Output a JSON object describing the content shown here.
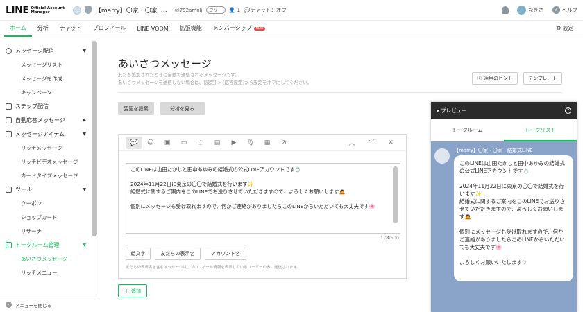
{
  "header": {
    "logo_main": "LINE",
    "logo_sub_1": "Official Account",
    "logo_sub_2": "Manager",
    "account_name": "【marry】〇家・〇家",
    "account_menu": "…",
    "account_id": "@792amnlj",
    "plan_badge": "フリー",
    "friends_count": "1",
    "chat_status": "チャット：オフ",
    "user_name": "なぎさ",
    "help_label": "ヘルプ"
  },
  "nav": {
    "tabs": [
      "ホーム",
      "分析",
      "チャット",
      "プロフィール",
      "LINE VOOM",
      "拡張機能",
      "メンバーシップ"
    ],
    "new_badge": "NEW",
    "settings_label": "設定"
  },
  "sidebar": {
    "groups": [
      {
        "label": "メッセージ配信",
        "items": [
          "メッセージリスト",
          "メッセージを作成",
          "キャンペーン"
        ]
      },
      {
        "label": "ステップ配信",
        "items": []
      },
      {
        "label": "自動応答メッセージ",
        "items": []
      },
      {
        "label": "メッセージアイテム",
        "items": [
          "リッチメッセージ",
          "リッチビデオメッセージ",
          "カードタイプメッセージ"
        ]
      },
      {
        "label": "ツール",
        "items": [
          "クーポン",
          "ショップカード",
          "リサーチ"
        ]
      },
      {
        "label": "トークルーム管理",
        "items": [
          "あいさつメッセージ",
          "リッチメニュー"
        ]
      }
    ],
    "footer_label": "メニューを閉じる"
  },
  "main": {
    "title": "あいさつメッセージ",
    "desc_line1": "友だち追加されたときに自動で送信されるメッセージです。",
    "desc_line2": "あいさつメッセージを送信しない場合は、[設定] > [応答設定]から設定をオフにしてください。",
    "hint_label": "活用のヒント",
    "template_label": "テンプレート",
    "suggest_label": "変更を提案",
    "analyze_label": "分析を見る",
    "message_text": "このLINEは山田たかしと田中あゆみの結婚式の公式LINEアカウントです💍\n\n2024年11月22日に東京の〇〇で結婚式を行います✨\n結婚式に関するご案内をこのLINEでお送りさせていただきますので、よろしくお願いします🙇\n\n個別にメッセージも受け取れますので、何かご連絡がありましたらこのLINEからいただいても大丈夫です🌸",
    "char_count": "178",
    "char_max": "/500",
    "insert_buttons": [
      "絵文字",
      "友だちの表示名",
      "アカウント名"
    ],
    "insert_note": "友だちの表示名を含むメッセージは、プロフィール情報を表示しているユーザーのみに送信されます。",
    "add_label": "追加"
  },
  "preview": {
    "title": "プレビュー",
    "tabs": [
      "トークルーム",
      "トークリスト"
    ],
    "sender": "【marry】〇家・〇家　結婚式LINE",
    "bubble_text": "このLINEは山田たかしと田中あゆみの結婚式の公式LINEアカウントです💍\n\n2024年11月22日に東京の〇〇で結婚式を行います✨\n結婚式に関するご案内をこのLINEでお送りさせていただきますので、よろしくお願いします🙇\n\n個別にメッセージも受け取れますので、何かご連絡がありましたらこのLINEからいただいても大丈夫です🌸\n\nよろしくお願いいたします♡"
  },
  "colors": {
    "accent": "#06c755",
    "preview_bg": "#8aa3c9",
    "preview_header": "#2b2b2b"
  }
}
